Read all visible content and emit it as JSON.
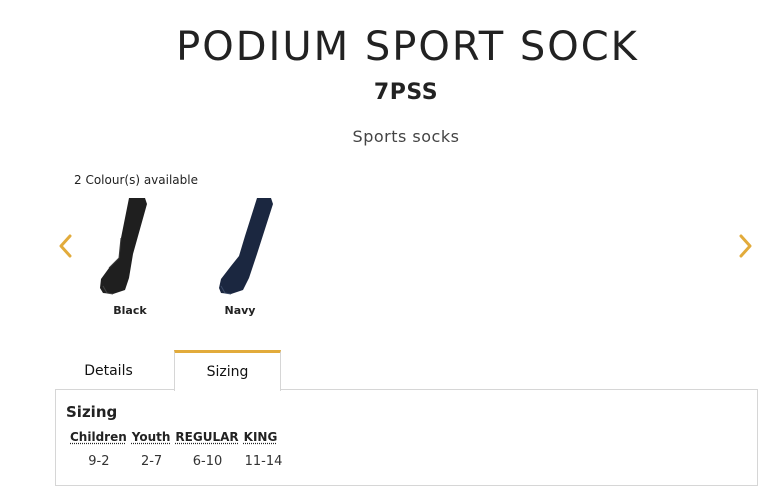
{
  "product": {
    "title": "PODIUM SPORT SOCK",
    "code": "7PSS",
    "subtitle": "Sports socks"
  },
  "colours": {
    "count_label": "2 Colour(s) available",
    "items": [
      {
        "label": "Black",
        "color": "#1f1f1f"
      },
      {
        "label": "Navy",
        "color": "#1b2740"
      }
    ]
  },
  "carousel": {
    "prev_icon": "chevron-left-icon",
    "next_icon": "chevron-right-icon",
    "accent": "#e2ab3b"
  },
  "tabs": [
    {
      "label": "Details",
      "active": false
    },
    {
      "label": "Sizing",
      "active": true
    }
  ],
  "sizing": {
    "heading": "Sizing",
    "columns": [
      "Children",
      "Youth",
      "REGULAR",
      "KING"
    ],
    "values": [
      "9-2",
      "2-7",
      "6-10",
      "11-14"
    ]
  }
}
